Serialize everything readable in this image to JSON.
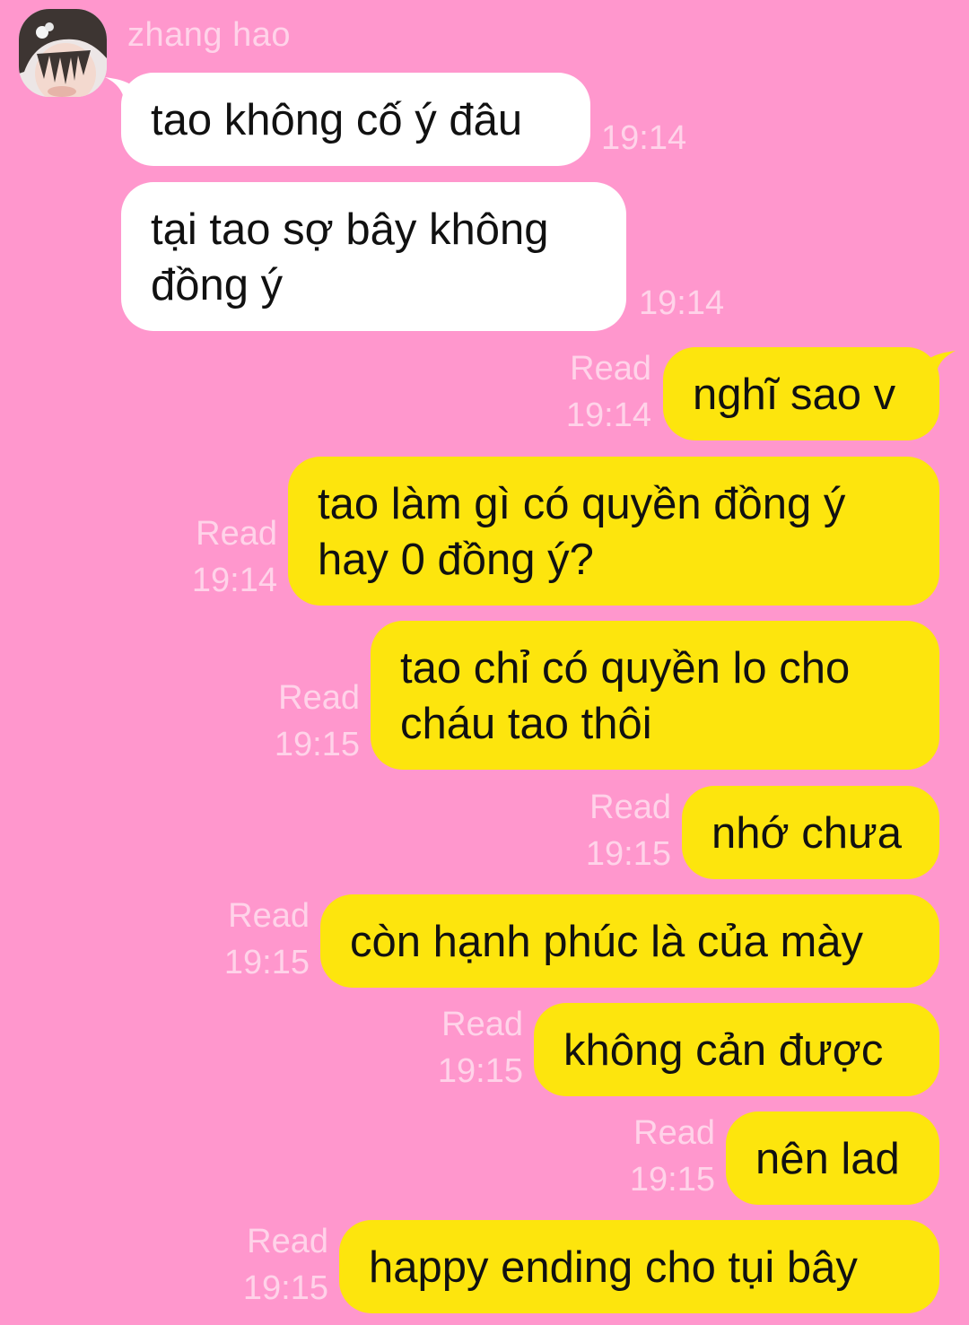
{
  "contact": {
    "name": "zhang hao"
  },
  "messages": [
    {
      "side": "in",
      "text": "tao không cố ý đâu",
      "time": "19:14"
    },
    {
      "side": "in",
      "text": "tại tao sợ bây không\nđồng ý",
      "time": "19:14"
    },
    {
      "side": "out",
      "text": "nghĩ sao v",
      "status": "Read",
      "time": "19:14"
    },
    {
      "side": "out",
      "text": "tao làm gì có quyền đồng ý\nhay 0 đồng ý?",
      "status": "Read",
      "time": "19:14"
    },
    {
      "side": "out",
      "text": "tao chỉ có quyền lo cho\ncháu tao thôi",
      "status": "Read",
      "time": "19:15"
    },
    {
      "side": "out",
      "text": "nhớ chưa",
      "status": "Read",
      "time": "19:15"
    },
    {
      "side": "out",
      "text": "còn hạnh phúc là của mày",
      "status": "Read",
      "time": "19:15"
    },
    {
      "side": "out",
      "text": "không cản được",
      "status": "Read",
      "time": "19:15"
    },
    {
      "side": "out",
      "text": "nên lad",
      "status": "Read",
      "time": "19:15"
    },
    {
      "side": "out",
      "text": "happy ending cho tụi bây",
      "status": "Read",
      "time": "19:15"
    }
  ],
  "colors": {
    "background": "#ff97cd",
    "incoming_bubble": "#ffffff",
    "outgoing_bubble": "#fde50d",
    "meta_text": "#ffd3e9"
  }
}
